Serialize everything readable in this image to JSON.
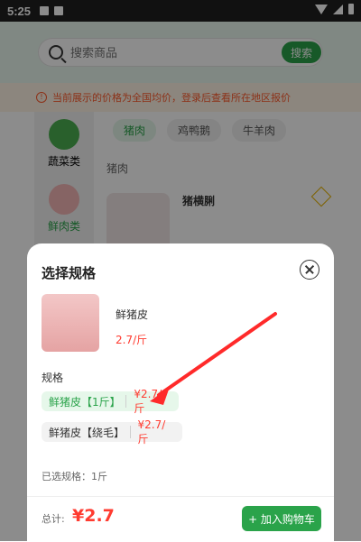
{
  "statusbar": {
    "time": "5:25"
  },
  "search": {
    "placeholder": "搜索商品",
    "button": "搜索"
  },
  "notice": {
    "text": "当前展示的价格为全国均价，登录后查看所在地区报价"
  },
  "sidebar": {
    "items": [
      {
        "label": "蔬菜类",
        "color": "#4caf50"
      },
      {
        "label": "鲜肉类",
        "color": "#2aa34a"
      }
    ]
  },
  "tabs": [
    "猪肉",
    "鸡鸭鹅",
    "牛羊肉"
  ],
  "section": {
    "title": "猪肉"
  },
  "product": {
    "name": "猪横脷"
  },
  "sheet": {
    "title": "选择规格",
    "item": {
      "name": "鲜猪皮",
      "price": "2.7/斤"
    },
    "spec_title": "规格",
    "options": [
      {
        "name": "鲜猪皮【1斤】",
        "price": "¥2.7/斤",
        "selected": true
      },
      {
        "name": "鲜猪皮【绕毛】",
        "price": "¥2.7/斤",
        "selected": false
      }
    ],
    "selected_text": "已选规格：1斤",
    "total_label": "总计:",
    "total_value": "¥2.7",
    "cart_button": "+ 加入购物车"
  }
}
